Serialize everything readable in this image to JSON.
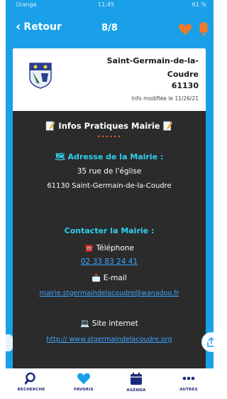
{
  "status_bar": {
    "carrier": "Orange",
    "time": "11:45",
    "battery": "61 %"
  },
  "nav": {
    "back_label": "Retour",
    "pager": "8/8",
    "favorite_icon": "heart-icon",
    "notify_icon": "bell-icon",
    "accent": "#f07a2a"
  },
  "header": {
    "town": "Saint-Germain-de-la-Coudre",
    "postal_code": "61130",
    "updated": "Info modifiée le 11/26/21"
  },
  "info": {
    "title": "📝 Infos Pratiques Mairie 📝",
    "dots": "••••••",
    "address_title": "🗺 Adresse de la Mairie :",
    "address_line1": "35 rue de l'église",
    "address_line2": "61130 Saint-Germain-de-la-Coudre",
    "contact_title": "Contacter la Mairie :",
    "phone_label": "☎️ Téléphone",
    "phone": "02 33 83 24 41",
    "email_label": "📩 E-mail",
    "email": "mairie.stgermaindelacoudre@wanadoo.fr",
    "site_label": "💻 Site internet",
    "site": "http:// www.stgermaindelacoudre.org"
  },
  "tabbar": {
    "tabs": [
      {
        "label": "RECHERCHE",
        "icon": "search-icon"
      },
      {
        "label": "FAVORIS",
        "icon": "heart-icon"
      },
      {
        "label": "AGENDA",
        "icon": "calendar-icon"
      },
      {
        "label": "AUTRES",
        "icon": "more-icon"
      }
    ]
  },
  "colors": {
    "primary": "#1aa0e8",
    "card": "#2b2b2b",
    "link": "#3aa6ff",
    "heading": "#2fd0f0",
    "tab_icon": "#1a2a7a"
  }
}
